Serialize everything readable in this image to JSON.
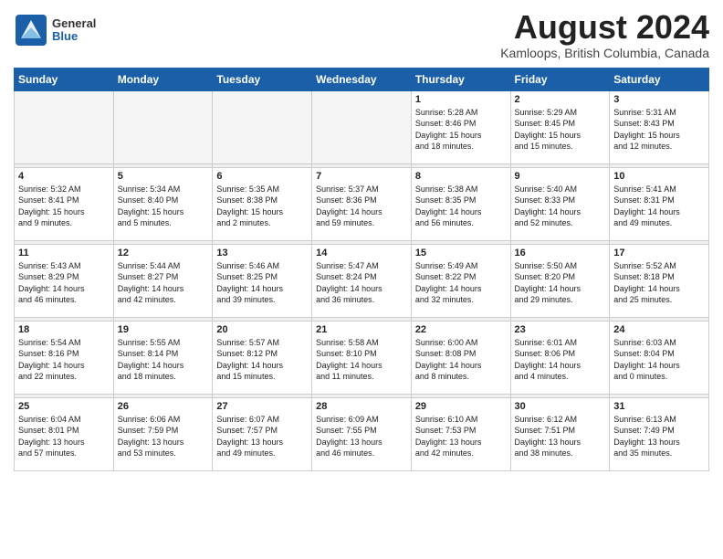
{
  "header": {
    "logo": {
      "general": "General",
      "blue": "Blue"
    },
    "title": "August 2024",
    "location": "Kamloops, British Columbia, Canada"
  },
  "calendar": {
    "weekdays": [
      "Sunday",
      "Monday",
      "Tuesday",
      "Wednesday",
      "Thursday",
      "Friday",
      "Saturday"
    ],
    "weeks": [
      [
        {
          "day": "",
          "info": ""
        },
        {
          "day": "",
          "info": ""
        },
        {
          "day": "",
          "info": ""
        },
        {
          "day": "",
          "info": ""
        },
        {
          "day": "1",
          "info": "Sunrise: 5:28 AM\nSunset: 8:46 PM\nDaylight: 15 hours\nand 18 minutes."
        },
        {
          "day": "2",
          "info": "Sunrise: 5:29 AM\nSunset: 8:45 PM\nDaylight: 15 hours\nand 15 minutes."
        },
        {
          "day": "3",
          "info": "Sunrise: 5:31 AM\nSunset: 8:43 PM\nDaylight: 15 hours\nand 12 minutes."
        }
      ],
      [
        {
          "day": "4",
          "info": "Sunrise: 5:32 AM\nSunset: 8:41 PM\nDaylight: 15 hours\nand 9 minutes."
        },
        {
          "day": "5",
          "info": "Sunrise: 5:34 AM\nSunset: 8:40 PM\nDaylight: 15 hours\nand 5 minutes."
        },
        {
          "day": "6",
          "info": "Sunrise: 5:35 AM\nSunset: 8:38 PM\nDaylight: 15 hours\nand 2 minutes."
        },
        {
          "day": "7",
          "info": "Sunrise: 5:37 AM\nSunset: 8:36 PM\nDaylight: 14 hours\nand 59 minutes."
        },
        {
          "day": "8",
          "info": "Sunrise: 5:38 AM\nSunset: 8:35 PM\nDaylight: 14 hours\nand 56 minutes."
        },
        {
          "day": "9",
          "info": "Sunrise: 5:40 AM\nSunset: 8:33 PM\nDaylight: 14 hours\nand 52 minutes."
        },
        {
          "day": "10",
          "info": "Sunrise: 5:41 AM\nSunset: 8:31 PM\nDaylight: 14 hours\nand 49 minutes."
        }
      ],
      [
        {
          "day": "11",
          "info": "Sunrise: 5:43 AM\nSunset: 8:29 PM\nDaylight: 14 hours\nand 46 minutes."
        },
        {
          "day": "12",
          "info": "Sunrise: 5:44 AM\nSunset: 8:27 PM\nDaylight: 14 hours\nand 42 minutes."
        },
        {
          "day": "13",
          "info": "Sunrise: 5:46 AM\nSunset: 8:25 PM\nDaylight: 14 hours\nand 39 minutes."
        },
        {
          "day": "14",
          "info": "Sunrise: 5:47 AM\nSunset: 8:24 PM\nDaylight: 14 hours\nand 36 minutes."
        },
        {
          "day": "15",
          "info": "Sunrise: 5:49 AM\nSunset: 8:22 PM\nDaylight: 14 hours\nand 32 minutes."
        },
        {
          "day": "16",
          "info": "Sunrise: 5:50 AM\nSunset: 8:20 PM\nDaylight: 14 hours\nand 29 minutes."
        },
        {
          "day": "17",
          "info": "Sunrise: 5:52 AM\nSunset: 8:18 PM\nDaylight: 14 hours\nand 25 minutes."
        }
      ],
      [
        {
          "day": "18",
          "info": "Sunrise: 5:54 AM\nSunset: 8:16 PM\nDaylight: 14 hours\nand 22 minutes."
        },
        {
          "day": "19",
          "info": "Sunrise: 5:55 AM\nSunset: 8:14 PM\nDaylight: 14 hours\nand 18 minutes."
        },
        {
          "day": "20",
          "info": "Sunrise: 5:57 AM\nSunset: 8:12 PM\nDaylight: 14 hours\nand 15 minutes."
        },
        {
          "day": "21",
          "info": "Sunrise: 5:58 AM\nSunset: 8:10 PM\nDaylight: 14 hours\nand 11 minutes."
        },
        {
          "day": "22",
          "info": "Sunrise: 6:00 AM\nSunset: 8:08 PM\nDaylight: 14 hours\nand 8 minutes."
        },
        {
          "day": "23",
          "info": "Sunrise: 6:01 AM\nSunset: 8:06 PM\nDaylight: 14 hours\nand 4 minutes."
        },
        {
          "day": "24",
          "info": "Sunrise: 6:03 AM\nSunset: 8:04 PM\nDaylight: 14 hours\nand 0 minutes."
        }
      ],
      [
        {
          "day": "25",
          "info": "Sunrise: 6:04 AM\nSunset: 8:01 PM\nDaylight: 13 hours\nand 57 minutes."
        },
        {
          "day": "26",
          "info": "Sunrise: 6:06 AM\nSunset: 7:59 PM\nDaylight: 13 hours\nand 53 minutes."
        },
        {
          "day": "27",
          "info": "Sunrise: 6:07 AM\nSunset: 7:57 PM\nDaylight: 13 hours\nand 49 minutes."
        },
        {
          "day": "28",
          "info": "Sunrise: 6:09 AM\nSunset: 7:55 PM\nDaylight: 13 hours\nand 46 minutes."
        },
        {
          "day": "29",
          "info": "Sunrise: 6:10 AM\nSunset: 7:53 PM\nDaylight: 13 hours\nand 42 minutes."
        },
        {
          "day": "30",
          "info": "Sunrise: 6:12 AM\nSunset: 7:51 PM\nDaylight: 13 hours\nand 38 minutes."
        },
        {
          "day": "31",
          "info": "Sunrise: 6:13 AM\nSunset: 7:49 PM\nDaylight: 13 hours\nand 35 minutes."
        }
      ]
    ]
  }
}
